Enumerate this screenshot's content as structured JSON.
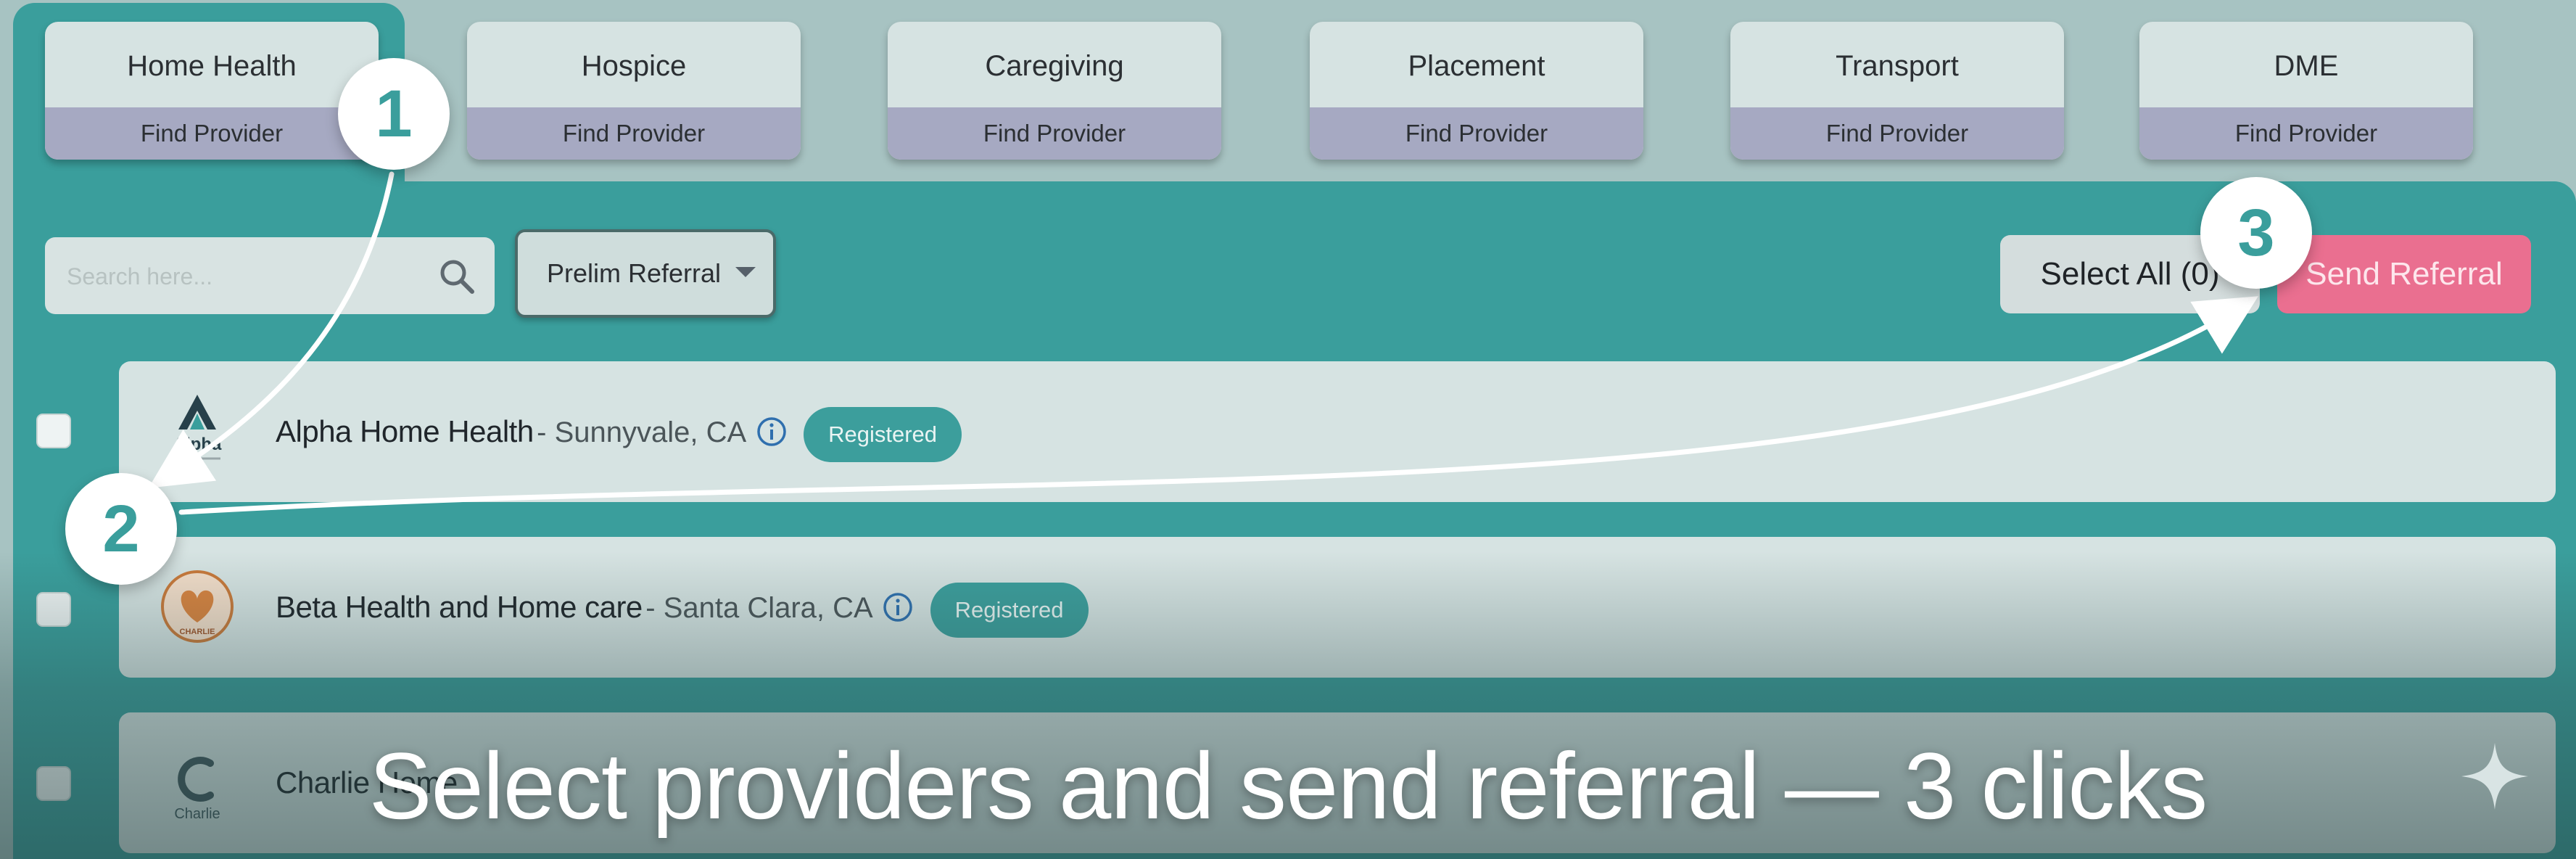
{
  "categories": [
    {
      "title": "Home Health",
      "action": "Find Provider"
    },
    {
      "title": "Hospice",
      "action": "Find Provider"
    },
    {
      "title": "Caregiving",
      "action": "Find Provider"
    },
    {
      "title": "Placement",
      "action": "Find Provider"
    },
    {
      "title": "Transport",
      "action": "Find Provider"
    },
    {
      "title": "DME",
      "action": "Find Provider"
    }
  ],
  "toolbar": {
    "search_placeholder": "Search here...",
    "referral_type": "Prelim Referral",
    "select_all_label": "Select All (0)",
    "send_referral_label": "Send Referral"
  },
  "providers": [
    {
      "name": "Alpha Home Health",
      "location": "Sunnyvale, CA",
      "badge": "Registered",
      "logo_text": "Alpha"
    },
    {
      "name": "Beta Health and Home care",
      "location": "Santa Clara, CA",
      "badge": "Registered",
      "logo_text": "CHARLIE"
    },
    {
      "name": "Charlie Home",
      "location": "",
      "badge": "",
      "logo_text": "Charlie"
    }
  ],
  "annotations": {
    "steps": [
      "1",
      "2",
      "3"
    ],
    "caption": "Select providers and send referral — 3 clicks"
  },
  "colors": {
    "teal": "#3a9e9c",
    "card": "#d6e3e2",
    "card_action_strip": "#a6a9c2",
    "send_button": "#ea6f90",
    "badge": "#3c9e9c"
  }
}
